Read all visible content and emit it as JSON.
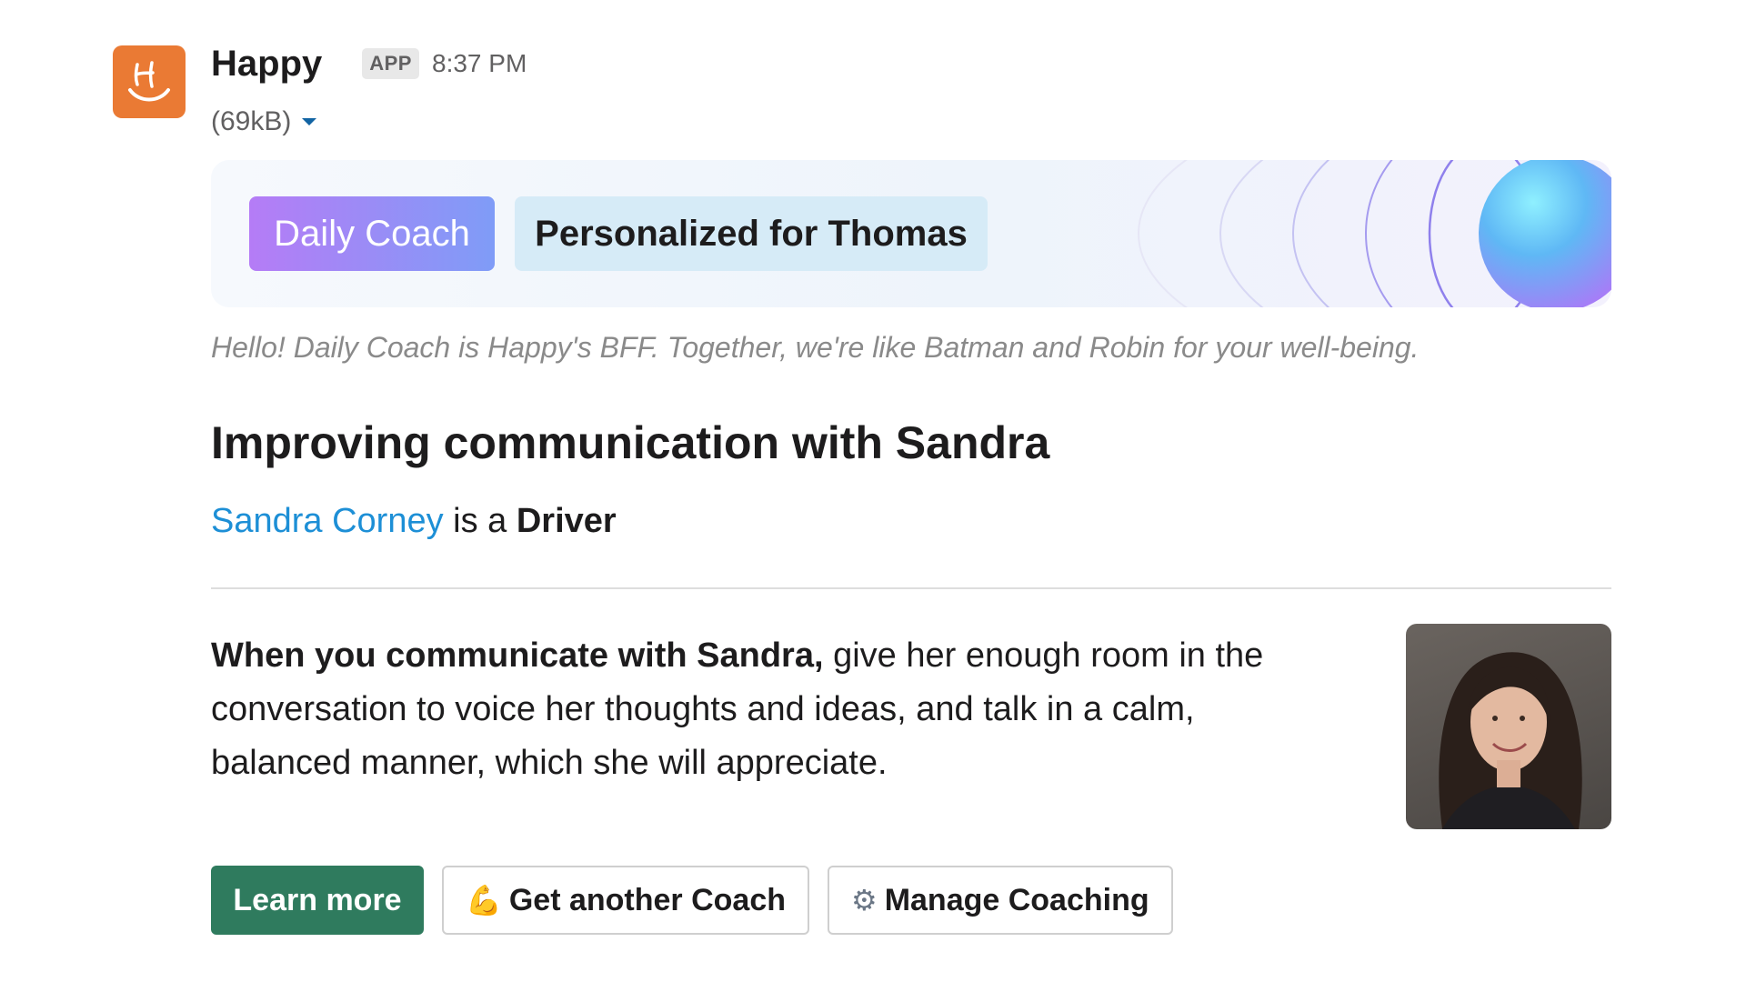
{
  "app": {
    "sender": "Happy",
    "badge": "APP",
    "timestamp": "8:37 PM",
    "file_size": "(69kB)",
    "brand_color": "#ea7a34"
  },
  "banner": {
    "tag_primary": "Daily Coach",
    "tag_secondary": "Personalized for Thomas",
    "gradient_start": "#b57cf6",
    "gradient_end": "#7f9cf7"
  },
  "message": {
    "intro": "Hello! Daily Coach is Happy's BFF. Together, we're like Batman and Robin  for your well-being.",
    "title": "Improving communication with Sandra",
    "person_link": "Sandra Corney",
    "is_a": "is a",
    "person_type": "Driver",
    "body_bold": "When you communicate with Sandra,",
    "body_rest": "give her enough room in the conversation to voice her thoughts and ideas, and talk in a calm, balanced manner, which she will appreciate."
  },
  "actions": {
    "learn_more": "Learn more",
    "get_another_icon": "💪",
    "get_another": "Get another Coach",
    "manage_icon": "⚙",
    "manage": "Manage Coaching",
    "primary_color": "#2f7b5e"
  },
  "icons": {
    "avatar": "happy-logo-icon",
    "caret": "caret-down-icon",
    "photo": "person-photo"
  }
}
